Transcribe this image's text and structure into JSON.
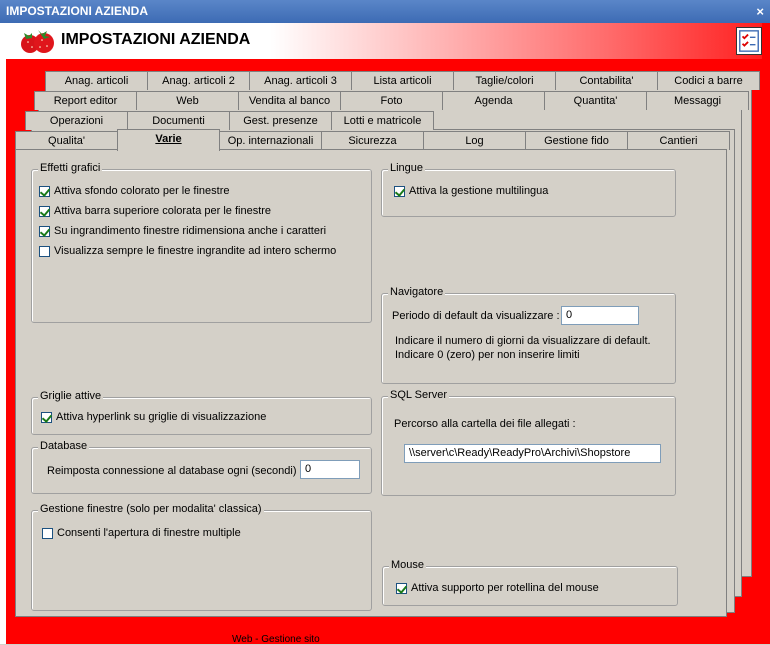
{
  "window": {
    "title": "IMPOSTAZIONI AZIENDA",
    "close_glyph": "×"
  },
  "header": {
    "title": "IMPOSTAZIONI AZIENDA",
    "logo_icon": "strawberry-icon",
    "right_icon": "checklist-icon"
  },
  "tabs": {
    "row1": [
      "Anag. articoli",
      "Anag. articoli 2",
      "Anag. articoli 3",
      "Lista articoli",
      "Taglie/colori",
      "Contabilita'",
      "Codici a barre"
    ],
    "row2": [
      "Report editor",
      "Web",
      "Vendita al banco",
      "Foto",
      "Agenda",
      "Quantita'",
      "Messaggi"
    ],
    "row3": [
      "Operazioni",
      "Documenti",
      "Gest. presenze",
      "Lotti e matricole"
    ],
    "row4": [
      "Qualita'",
      "Varie",
      "Op. internazionali",
      "Sicurezza",
      "Log",
      "Gestione fido",
      "Cantieri"
    ],
    "active": "Varie"
  },
  "effetti": {
    "title": "Effetti grafici",
    "items": [
      {
        "label": "Attiva sfondo colorato per le finestre",
        "checked": true
      },
      {
        "label": "Attiva barra superiore colorata per le finestre",
        "checked": true
      },
      {
        "label": "Su ingrandimento finestre ridimensiona anche i caratteri",
        "checked": true
      },
      {
        "label": "Visualizza sempre le finestre ingrandite ad intero schermo",
        "checked": false
      }
    ]
  },
  "lingue": {
    "title": "Lingue",
    "item": {
      "label": "Attiva la gestione multilingua",
      "checked": true
    }
  },
  "navigatore": {
    "title": "Navigatore",
    "period_label": "Periodo di default da visualizzare :",
    "period_value": "0",
    "hint1": "Indicare il numero di giorni da visualizzare di default.",
    "hint2": "Indicare 0 (zero) per non inserire limiti"
  },
  "griglie": {
    "title": "Griglie attive",
    "item": {
      "label": "Attiva hyperlink su griglie di visualizzazione",
      "checked": true
    }
  },
  "database": {
    "title": "Database",
    "label": "Reimposta connessione al database ogni (secondi) :",
    "value": "0"
  },
  "sql": {
    "title": "SQL Server",
    "label": "Percorso alla cartella dei file allegati :",
    "value": "\\\\server\\c\\Ready\\ReadyPro\\Archivi\\Shopstore"
  },
  "gestione": {
    "title": "Gestione finestre (solo per modalita' classica)",
    "item": {
      "label": "Consenti l'apertura di finestre multiple",
      "checked": false
    }
  },
  "mouse": {
    "title": "Mouse",
    "item": {
      "label": "Attiva supporto per rotellina del mouse",
      "checked": true
    }
  },
  "background_fragment": "Web - Gestione sito",
  "colors": {
    "frame": "#ff0000",
    "titlebar": "#3d6bb4",
    "panel": "#d4d0c8"
  }
}
